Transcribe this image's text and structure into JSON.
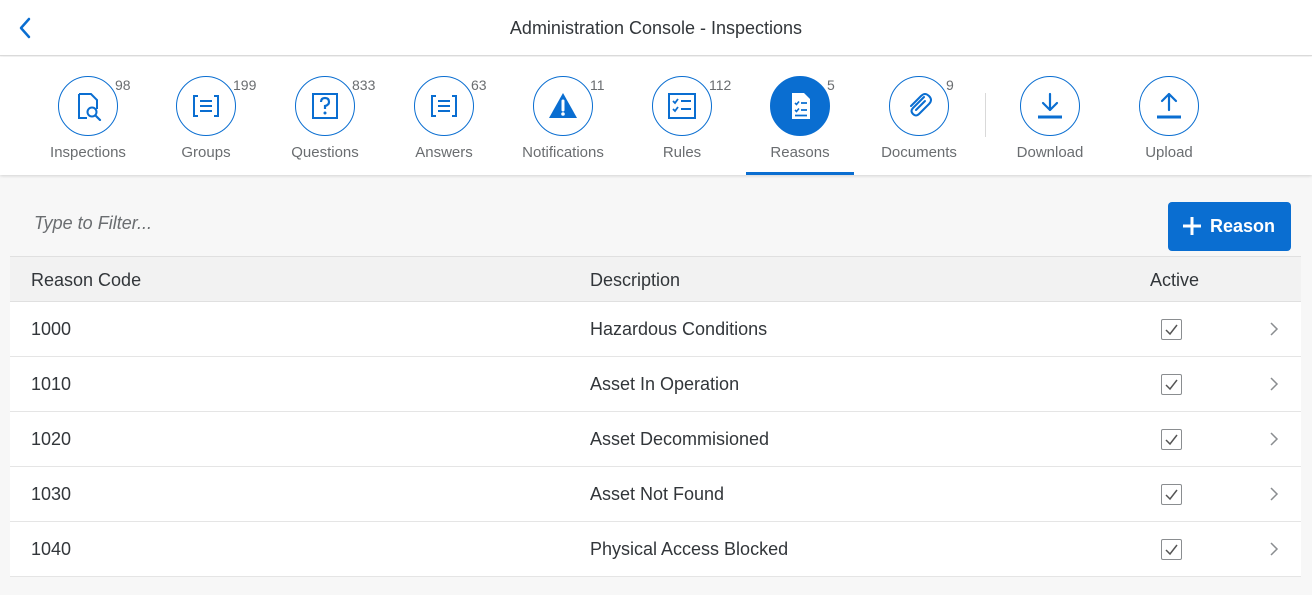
{
  "header": {
    "title": "Administration Console - Inspections",
    "back_icon": "chevron-left-icon"
  },
  "tabs": [
    {
      "label": "Inspections",
      "count": "98",
      "icon": "inspection-search-icon",
      "selected": false
    },
    {
      "label": "Groups",
      "count": "199",
      "icon": "list-icon",
      "selected": false
    },
    {
      "label": "Questions",
      "count": "833",
      "icon": "question-mark-icon",
      "selected": false
    },
    {
      "label": "Answers",
      "count": "63",
      "icon": "list-icon",
      "selected": false
    },
    {
      "label": "Notifications",
      "count": "11",
      "icon": "warning-icon",
      "selected": false
    },
    {
      "label": "Rules",
      "count": "112",
      "icon": "checklist-icon",
      "selected": false
    },
    {
      "label": "Reasons",
      "count": "5",
      "icon": "checklist-document-icon",
      "selected": true
    },
    {
      "label": "Documents",
      "count": "9",
      "icon": "paperclip-icon",
      "selected": false
    },
    {
      "label": "Download",
      "count": "",
      "icon": "download-icon",
      "selected": false
    },
    {
      "label": "Upload",
      "count": "",
      "icon": "upload-icon",
      "selected": false
    }
  ],
  "filter": {
    "placeholder": "Type to Filter...",
    "value": ""
  },
  "add_button": {
    "label": "Reason",
    "icon": "plus-icon"
  },
  "table": {
    "columns": [
      "Reason Code",
      "Description",
      "Active"
    ],
    "rows": [
      {
        "code": "1000",
        "description": "Hazardous Conditions",
        "active": true
      },
      {
        "code": "1010",
        "description": "Asset In Operation",
        "active": true
      },
      {
        "code": "1020",
        "description": "Asset Decommisioned",
        "active": true
      },
      {
        "code": "1030",
        "description": "Asset Not Found",
        "active": true
      },
      {
        "code": "1040",
        "description": "Physical Access Blocked",
        "active": true
      }
    ]
  },
  "colors": {
    "accent": "#0a6ed1",
    "text": "#32363a",
    "muted": "#6a6d70",
    "background": "#f7f7f7"
  }
}
